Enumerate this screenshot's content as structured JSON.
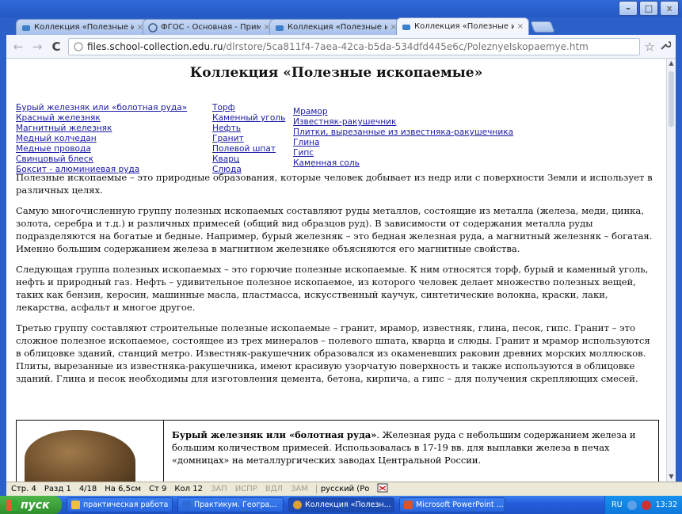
{
  "window": {
    "buttons": [
      {
        "name": "minimize",
        "glyph": "–"
      },
      {
        "name": "maximize",
        "glyph": "□"
      },
      {
        "name": "close",
        "glyph": "x"
      }
    ]
  },
  "tabs": [
    {
      "title": "Коллекция «Полезные ископ",
      "active": false,
      "favicon_color": "#3d7fc9"
    },
    {
      "title": "ФГОС - Основная - Примерны",
      "active": false,
      "favicon_color": "#3f5a8a"
    },
    {
      "title": "Коллекция «Полезные ископ",
      "active": false,
      "favicon_color": "#3d7fc9"
    },
    {
      "title": "Коллекция «Полезные ископ",
      "active": true,
      "favicon_color": "#3d7fc9"
    }
  ],
  "toolbar": {
    "back": "←",
    "forward": "→",
    "reload": "C",
    "url_host": "files.school-collection.edu.ru",
    "url_path": "/dlrstore/5ca811f4-7aea-42ca-b5da-534dfd445e6c/PoleznyeIskopaemye.htm",
    "star": "☆",
    "wrench": "🔧"
  },
  "page": {
    "title": "Коллекция «Полезные ископаемые»",
    "links_col1": [
      "Бурый железняк или «болотная руда»",
      "Красный железняк",
      "Магнитный железняк",
      "Медный колчедан",
      "Медные провода",
      "Свинцовый блеск",
      "Боксит - алюминиевая руда"
    ],
    "links_col2": [
      "Торф",
      "Каменный уголь",
      "Нефть",
      "Гранит",
      "Полевой шпат",
      "Кварц",
      "Слюда"
    ],
    "links_col3": [
      "Мрамор",
      "Известняк-ракушечник",
      "Плитки, вырезанные из известняка-ракушечника",
      "Глина",
      "Гипс",
      "Каменная соль"
    ],
    "paragraphs": [
      "Полезные ископаемые – это природные образования, которые человек добывает из недр или с поверхности Земли и использует в различных целях.",
      "Самую многочисленную группу полезных ископаемых составляют руды металлов, состоящие из металла (железа, меди, цинка, золота, серебра и т.д.) и различных примесей (общий вид образцов руд). В зависимости от содержания металла руды подразделяются на богатые и бедные. Например, бурый железняк – это бедная железная руда, а магнитный железняк – богатая. Именно большим содержанием железа в магнитном железняке объясняются его магнитные свойства.",
      "Следующая группа полезных ископаемых – это горючие полезные ископаемые. К ним относятся торф, бурый и каменный уголь, нефть и природный газ. Нефть – удивительное полезное ископаемое, из которого человек делает множество полезных вещей, таких как бензин, керосин, машинные масла, пластмасса, искусственный каучук, синтетические волокна, краски, лаки, лекарства, асфальт и многое другое.",
      "Третью группу составляют строительные полезные ископаемые – гранит, мрамор, известняк, глина, песок, гипс. Гранит – это сложное полезное ископаемое, состоящее из трех минералов – полевого шпата, кварца и слюды. Гранит и мрамор используются в облицовке зданий, станций метро. Известняк-ракушечник образовался из окаменевших раковин древних морских моллюсков. Плиты, вырезанные из известняка-ракушечника, имеют красивую узорчатую поверхность и также используются в облицовке зданий. Глина и песок необходимы для изготовления цемента, бетона, кирпича, а гипс – для получения скрепляющих смесей."
    ],
    "card": {
      "heading": "Бурый железняк или «болотная руда»",
      "text": ". Железная руда с небольшим содержанием железа и большим количеством примесей. Использовалась в 17-19 вв. для выплавки железа в печах «домницах» на металлургических заводах Центральной России."
    }
  },
  "statusbar": {
    "page": "Стр. 4",
    "section": "Разд 1",
    "pages": "4/18",
    "position": "На 6,5см",
    "line": "Ст 9",
    "column": "Кол 12",
    "modes": [
      "ЗАП",
      "ИСПР",
      "ВДЛ",
      "ЗАМ"
    ],
    "language": "русский (Ро"
  },
  "taskbar": {
    "start_label": "пуск",
    "tasks": [
      {
        "label": "практическая работа",
        "active": false,
        "icon_color": "#f0c040"
      },
      {
        "label": "Практикум. Геогра...",
        "active": false,
        "icon_color": "#2e6bd6"
      },
      {
        "label": "Коллекция «Полезн...",
        "active": true,
        "icon_color": "#e0a030"
      },
      {
        "label": "Microsoft PowerPoint ...",
        "active": false,
        "icon_color": "#d9542b"
      }
    ],
    "lang": "RU",
    "clock": "13:32"
  }
}
